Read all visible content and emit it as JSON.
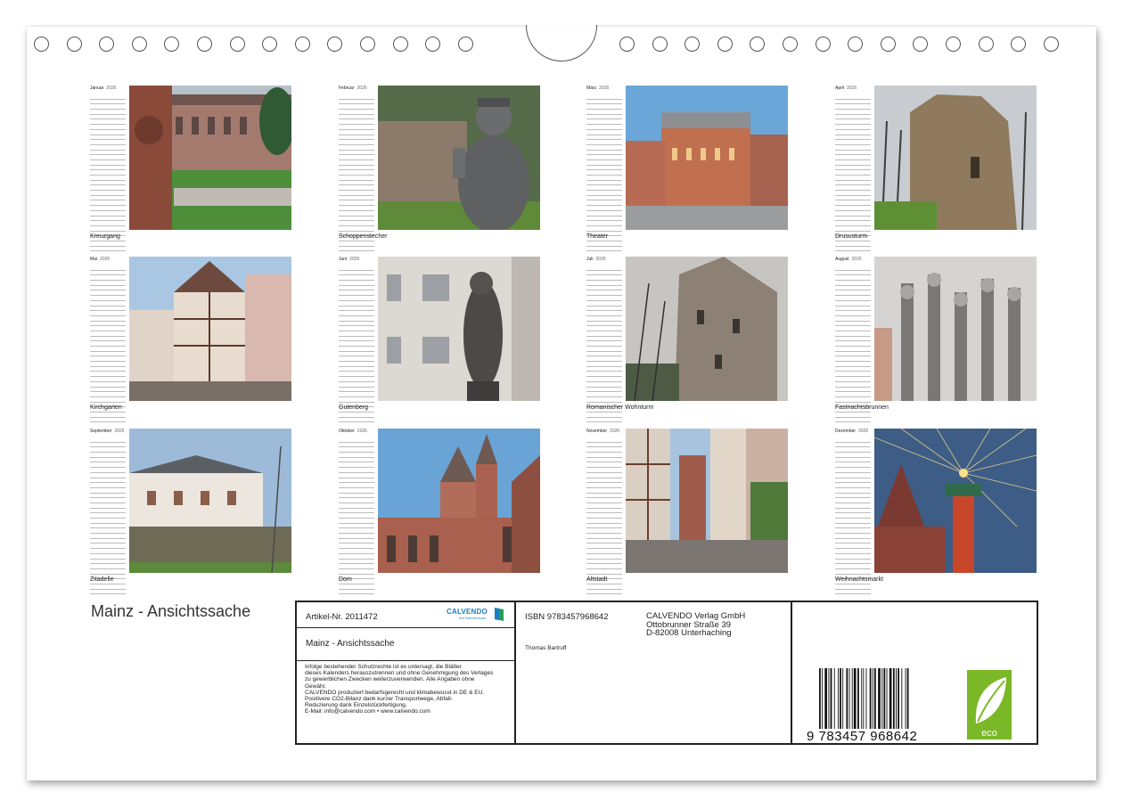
{
  "calendar": {
    "year": "2026",
    "months": [
      {
        "name": "Januar",
        "caption": "Kreuzgang"
      },
      {
        "name": "Februar",
        "caption": "Schoppenstecher"
      },
      {
        "name": "März",
        "caption": "Theater"
      },
      {
        "name": "April",
        "caption": "Drususturm"
      },
      {
        "name": "Mai",
        "caption": "Kirchgarten"
      },
      {
        "name": "Juni",
        "caption": "Gutenberg"
      },
      {
        "name": "Juli",
        "caption": "Romanischer Wohnturm"
      },
      {
        "name": "August",
        "caption": "Fastnachtsbrunnen"
      },
      {
        "name": "September",
        "caption": "Zitadelle"
      },
      {
        "name": "Oktober",
        "caption": "Dom"
      },
      {
        "name": "November",
        "caption": "Altstadt"
      },
      {
        "name": "Dezember",
        "caption": "Weihnachtsmarkt"
      }
    ]
  },
  "product": {
    "title": "Mainz - Ansichtssache",
    "article": "Artikel-Nr. 2011472",
    "brand": "CALVENDO",
    "brand_slogan": "Ihre Kalenderstudio",
    "isbn_line": "ISBN 9783457968642",
    "author": "Thomas Bartruff",
    "publisher": [
      "CALVENDO Verlag GmbH",
      "Ottobrunner Straße 39",
      "D-82008 Unterhaching"
    ],
    "legal": [
      "Infolge bestehender Schutzrechte ist es untersagt, die Blätter",
      "dieses Kalenders herauszutrennen und ohne Genehmigung des Verlages",
      "zu gewerblichen Zwecken weiterzuverwenden. Alle Angaben ohne",
      "Gewähr.",
      "CALVENDO produziert bedarfsgerecht und klimabewusst in DE & EU.",
      "Positivere CO2-Bilanz dank kurzer Transportwege, Abfall-",
      "Reduzierung dank Einzelstückfertigung.",
      "E-Mail: info@calvendo.com • www.calvendo.com"
    ],
    "barcode_number": "9   783457   968642",
    "eco_label": "eco"
  },
  "colors": {
    "brand_blue": "#1a7fbf",
    "eco_green": "#7ab827"
  }
}
